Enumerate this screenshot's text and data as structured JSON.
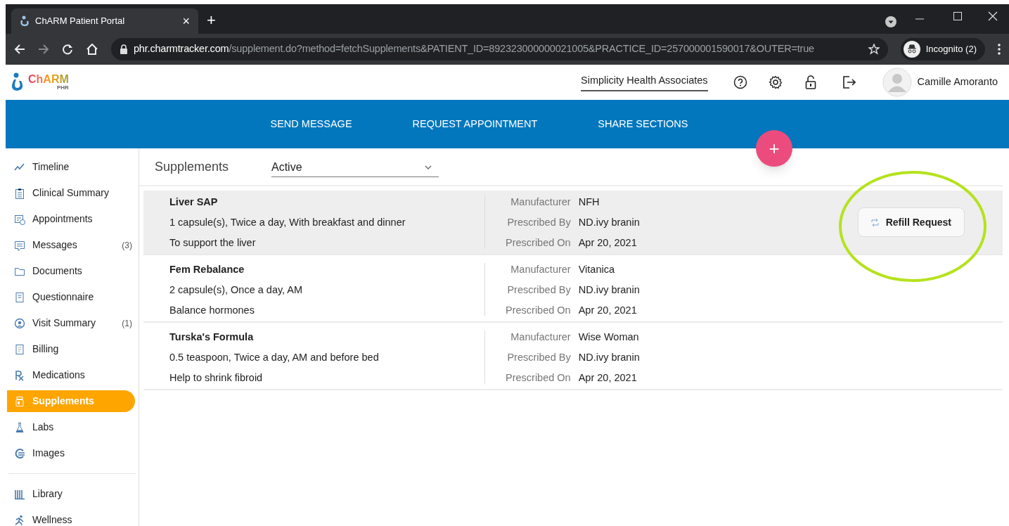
{
  "browser": {
    "tab_title": "ChARM Patient Portal",
    "tab_close": "×",
    "new_tab": "+",
    "url_host": "phr.charmtracker.com",
    "url_path": "/supplement.do?method=fetchSupplements&PATIENT_ID=892323000000021005&PRACTICE_ID=257000001590017&OUTER=true",
    "profile": "Incognito (2)"
  },
  "header": {
    "logo": "ChARM",
    "logo_sub": "PHR",
    "practice": "Simplicity Health Associates",
    "user": "Camille Amoranto"
  },
  "nav": [
    "SEND MESSAGE",
    "REQUEST APPOINTMENT",
    "SHARE SECTIONS"
  ],
  "fab": "+",
  "sidebar": {
    "items": [
      {
        "label": "Timeline",
        "selected": false
      },
      {
        "label": "Clinical Summary",
        "selected": false
      },
      {
        "label": "Appointments",
        "selected": false
      },
      {
        "label": "Messages",
        "count": "(3)",
        "selected": false
      },
      {
        "label": "Documents",
        "selected": false
      },
      {
        "label": "Questionnaire",
        "selected": false
      },
      {
        "label": "Visit Summary",
        "count": "(1)",
        "selected": false
      },
      {
        "label": "Billing",
        "selected": false
      },
      {
        "label": "Medications",
        "selected": false
      },
      {
        "label": "Supplements",
        "selected": true
      },
      {
        "label": "Labs",
        "selected": false
      },
      {
        "label": "Images",
        "selected": false
      }
    ],
    "bottom_items": [
      {
        "label": "Library",
        "selected": false
      },
      {
        "label": "Wellness",
        "selected": false
      }
    ]
  },
  "content": {
    "title": "Supplements",
    "filter": "Active",
    "rows": [
      {
        "name": "Liver SAP",
        "dosage": "1 capsule(s), Twice a day, With breakfast and dinner",
        "purpose": "To support the liver",
        "selected": true,
        "action": "Refill Request",
        "details": [
          {
            "label": "Manufacturer",
            "value": "NFH"
          },
          {
            "label": "Prescribed By",
            "value": "ND.ivy branin"
          },
          {
            "label": "Prescribed On",
            "value": "Apr 20, 2021"
          }
        ]
      },
      {
        "name": "Fem Rebalance",
        "dosage": "2 capsule(s), Once a day, AM",
        "purpose": "Balance hormones",
        "selected": false,
        "details": [
          {
            "label": "Manufacturer",
            "value": "Vitanica"
          },
          {
            "label": "Prescribed By",
            "value": "ND.ivy branin"
          },
          {
            "label": "Prescribed On",
            "value": "Apr 20, 2021"
          }
        ]
      },
      {
        "name": "Turska's Formula",
        "dosage": "0.5 teaspoon, Twice a day, AM and before bed",
        "purpose": "Help to shrink fibroid",
        "selected": false,
        "details": [
          {
            "label": "Manufacturer",
            "value": "Wise Woman"
          },
          {
            "label": "Prescribed By",
            "value": "ND.ivy branin"
          },
          {
            "label": "Prescribed On",
            "value": "Apr 20, 2021"
          }
        ]
      }
    ]
  }
}
